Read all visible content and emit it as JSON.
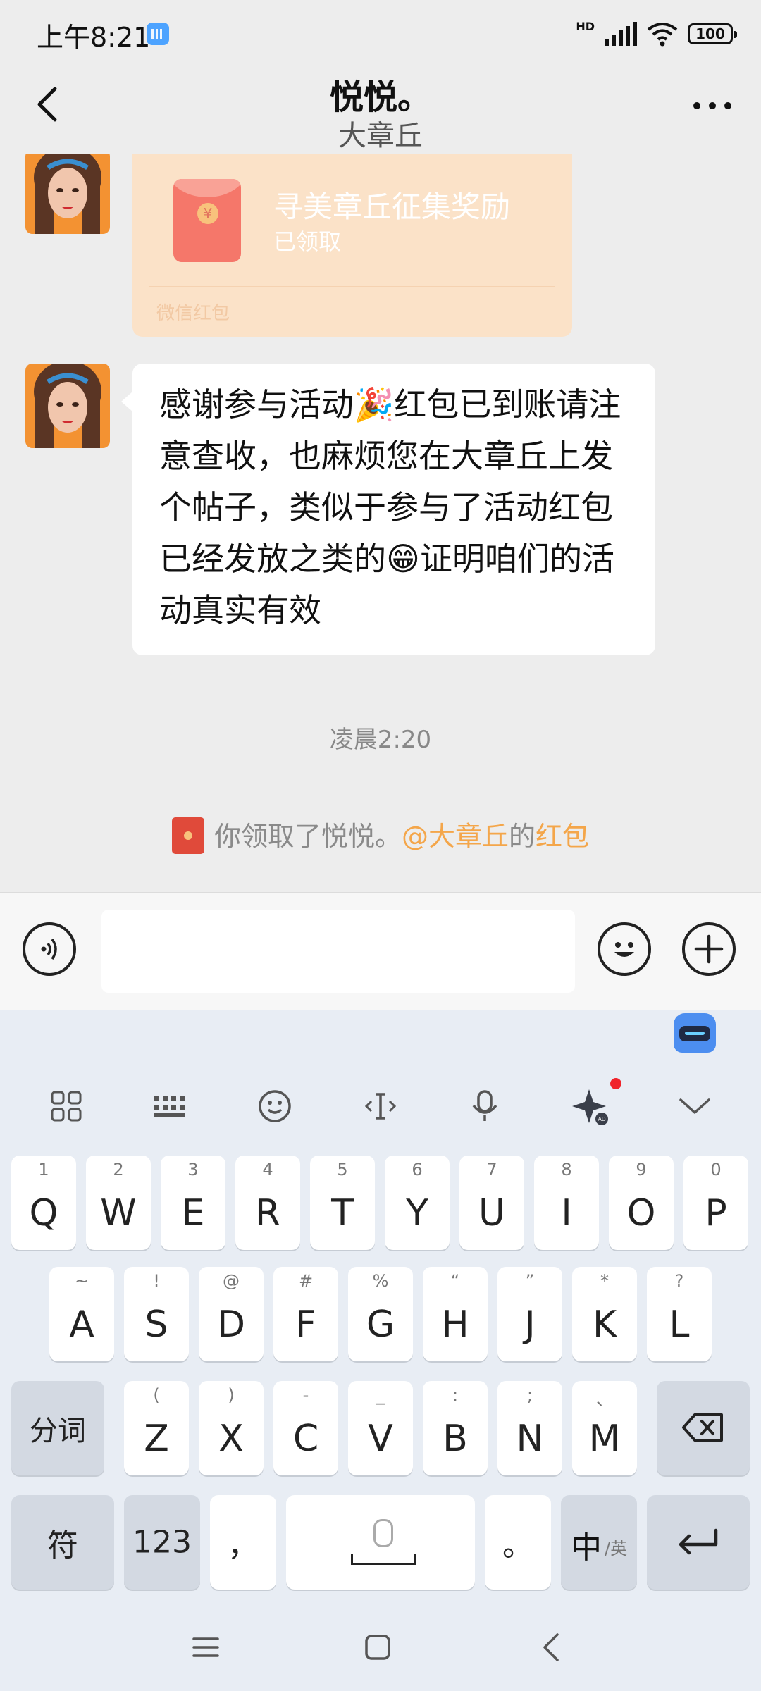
{
  "status_bar": {
    "time": "上午8:21",
    "network": "HD",
    "battery": "100"
  },
  "header": {
    "title": "悦悦。",
    "subtitle": "大章丘",
    "more_label": "..."
  },
  "chat": {
    "red_packet": {
      "title": "寻美章丘征集奖励",
      "status": "已领取",
      "footer": "微信红包",
      "coin": "¥"
    },
    "message_text": "感谢参与活动🎉红包已到账请注意查收，也麻烦您在大章丘上发个帖子，类似于参与了活动红包已经发放之类的😁证明咱们的活动真实有效",
    "timestamp": "凌晨2:20",
    "system_message": {
      "prefix": "你领取了悦悦。",
      "mention": "@大章丘",
      "middle": "的",
      "link": "红包"
    }
  },
  "input": {
    "value": "",
    "placeholder": ""
  },
  "keyboard": {
    "row1": [
      {
        "main": "Q",
        "sub": "1"
      },
      {
        "main": "W",
        "sub": "2"
      },
      {
        "main": "E",
        "sub": "3"
      },
      {
        "main": "R",
        "sub": "4"
      },
      {
        "main": "T",
        "sub": "5"
      },
      {
        "main": "Y",
        "sub": "6"
      },
      {
        "main": "U",
        "sub": "7"
      },
      {
        "main": "I",
        "sub": "8"
      },
      {
        "main": "O",
        "sub": "9"
      },
      {
        "main": "P",
        "sub": "0"
      }
    ],
    "row2": [
      {
        "main": "A",
        "sub": "~"
      },
      {
        "main": "S",
        "sub": "!"
      },
      {
        "main": "D",
        "sub": "@"
      },
      {
        "main": "F",
        "sub": "#"
      },
      {
        "main": "G",
        "sub": "%"
      },
      {
        "main": "H",
        "sub": "“"
      },
      {
        "main": "J",
        "sub": "”"
      },
      {
        "main": "K",
        "sub": "*"
      },
      {
        "main": "L",
        "sub": "?"
      }
    ],
    "row3": [
      {
        "main": "Z",
        "sub": "("
      },
      {
        "main": "X",
        "sub": ")"
      },
      {
        "main": "C",
        "sub": "-"
      },
      {
        "main": "V",
        "sub": "_"
      },
      {
        "main": "B",
        "sub": ":"
      },
      {
        "main": "N",
        "sub": ";"
      },
      {
        "main": "M",
        "sub": "、"
      }
    ],
    "segment_label": "分词",
    "symbol_label": "符",
    "num_label": "123",
    "comma_label": "，",
    "period_label": "。",
    "lang_label": "中",
    "lang_alt_label": "/英",
    "ai_badge": "AD"
  },
  "colors": {
    "accent": "#f4a64a",
    "red_packet": "#fbe2c8",
    "keyboard_bg": "#e8edf4"
  }
}
